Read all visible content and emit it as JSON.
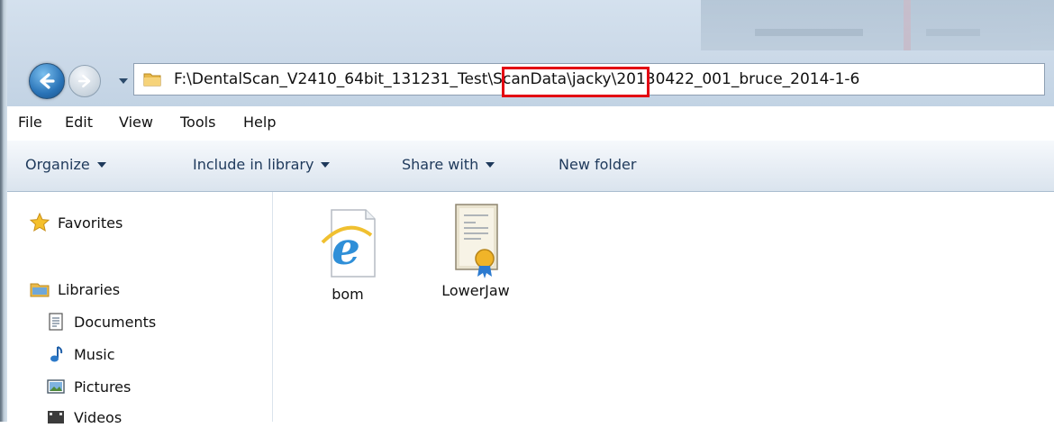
{
  "address_bar": {
    "path": "F:\\DentalScan_V2410_64bit_131231_Test\\ScanData\\jacky\\20130422_001_bruce_2014-1-6"
  },
  "menu": [
    "File",
    "Edit",
    "View",
    "Tools",
    "Help"
  ],
  "toolbar": {
    "organize": "Organize",
    "include_in_library": "Include in library",
    "share_with": "Share with",
    "new_folder": "New folder"
  },
  "nav_pane": {
    "favorites": "Favorites",
    "libraries": "Libraries",
    "documents": "Documents",
    "music": "Music",
    "pictures": "Pictures",
    "videos": "Videos"
  },
  "files": [
    {
      "name": "bom",
      "icon": "internet-explorer-file-icon"
    },
    {
      "name": "LowerJaw",
      "icon": "certificate-file-icon"
    }
  ],
  "colors": {
    "highlight": "#e30613",
    "accent": "#2a74b8"
  }
}
